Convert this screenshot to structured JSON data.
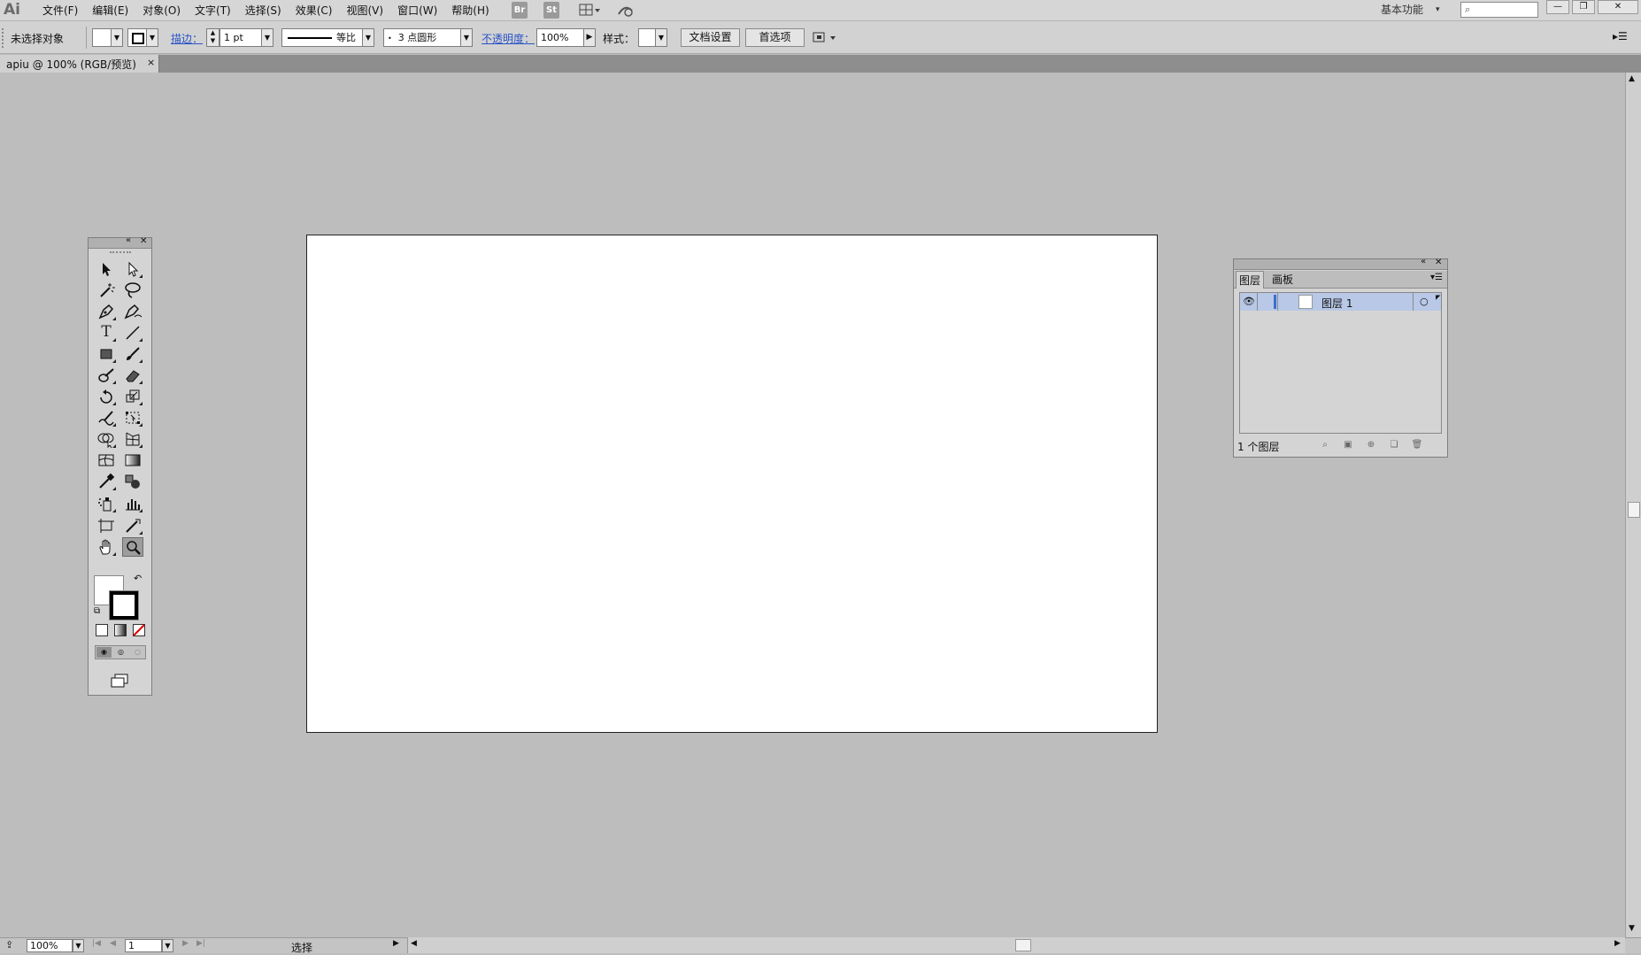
{
  "app": {
    "logo": "Ai"
  },
  "menu": {
    "items": [
      "文件(F)",
      "编辑(E)",
      "对象(O)",
      "文字(T)",
      "选择(S)",
      "效果(C)",
      "视图(V)",
      "窗口(W)",
      "帮助(H)"
    ],
    "bridge": "Br",
    "stock": "St",
    "workspace": "基本功能",
    "search_icon": "search-icon"
  },
  "control_bar": {
    "selection_status": "未选择对象",
    "stroke_label": "描边",
    "stroke_weight": "1 pt",
    "stroke_profile": "等比",
    "brush": "3 点圆形",
    "opacity_label": "不透明度",
    "opacity": "100%",
    "style_label": "样式",
    "doc_setup_button": "文档设置",
    "preferences_button": "首选项"
  },
  "document_tab": {
    "title": "apiu @ 100% (RGB/预览)",
    "close": "×"
  },
  "toolbox": {
    "tools": [
      [
        "selection-tool",
        "direct-selection-tool"
      ],
      [
        "magic-wand-tool",
        "lasso-tool"
      ],
      [
        "pen-tool",
        "curvature-tool"
      ],
      [
        "type-tool",
        "line-segment-tool"
      ],
      [
        "rectangle-tool",
        "paintbrush-tool"
      ],
      [
        "blob-brush-tool",
        "eraser-tool"
      ],
      [
        "rotate-tool",
        "scale-tool"
      ],
      [
        "warp-tool",
        "free-transform-tool"
      ],
      [
        "shape-builder-tool",
        "perspective-grid-tool"
      ],
      [
        "mesh-tool",
        "gradient-tool"
      ],
      [
        "eyedropper-tool",
        "blend-tool"
      ],
      [
        "symbol-sprayer-tool",
        "column-graph-tool"
      ],
      [
        "artboard-tool",
        "slice-tool"
      ],
      [
        "hand-tool",
        "zoom-tool"
      ]
    ],
    "active_tool": "zoom-tool"
  },
  "layers_panel": {
    "tabs": [
      "图层",
      "画板"
    ],
    "layers": [
      {
        "name": "图层 1"
      }
    ],
    "footer_count": "1 个图层"
  },
  "status_bar": {
    "zoom": "100%",
    "artboard_number": "1",
    "tool_status": "选择"
  },
  "colors": {
    "canvas_bg": "#bdbdbd",
    "layer_highlight": "#b8c8e6",
    "link_blue": "#2a53c7"
  }
}
